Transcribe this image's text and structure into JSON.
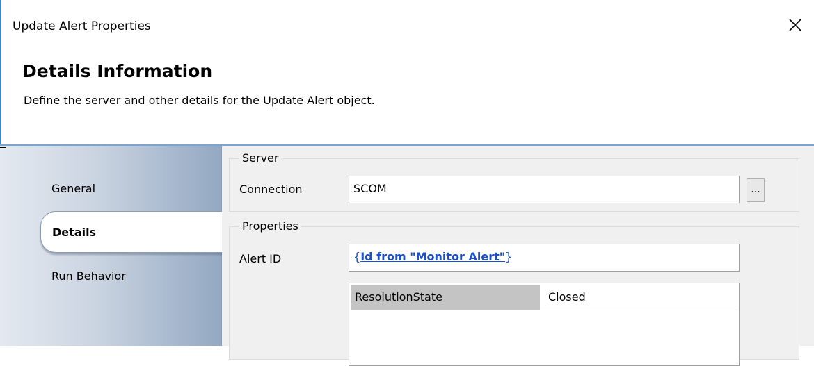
{
  "window": {
    "title": "Update Alert Properties"
  },
  "header": {
    "title": "Details Information",
    "subtitle": "Define the server and other details for the Update Alert object."
  },
  "nav": {
    "items": [
      {
        "label": "General",
        "selected": false
      },
      {
        "label": "Details",
        "selected": true
      },
      {
        "label": "Run Behavior",
        "selected": false
      }
    ]
  },
  "server": {
    "legend": "Server",
    "connection_label": "Connection",
    "connection_value": "SCOM",
    "browse_label": "..."
  },
  "properties": {
    "legend": "Properties",
    "alert_id_label": "Alert ID",
    "alert_id_open": "{",
    "alert_id_link": "Id from \"Monitor Alert\"",
    "alert_id_close": "}",
    "rows": [
      {
        "name": "ResolutionState",
        "value": "Closed"
      }
    ]
  },
  "colors": {
    "accent_border": "#3c87c8",
    "link": "#1a4fc8",
    "nav_gradient_start": "#e4e9f0",
    "nav_gradient_end": "#93a8c2",
    "content_bg": "#f0f0f0"
  },
  "icons": {
    "close": "close-icon"
  }
}
